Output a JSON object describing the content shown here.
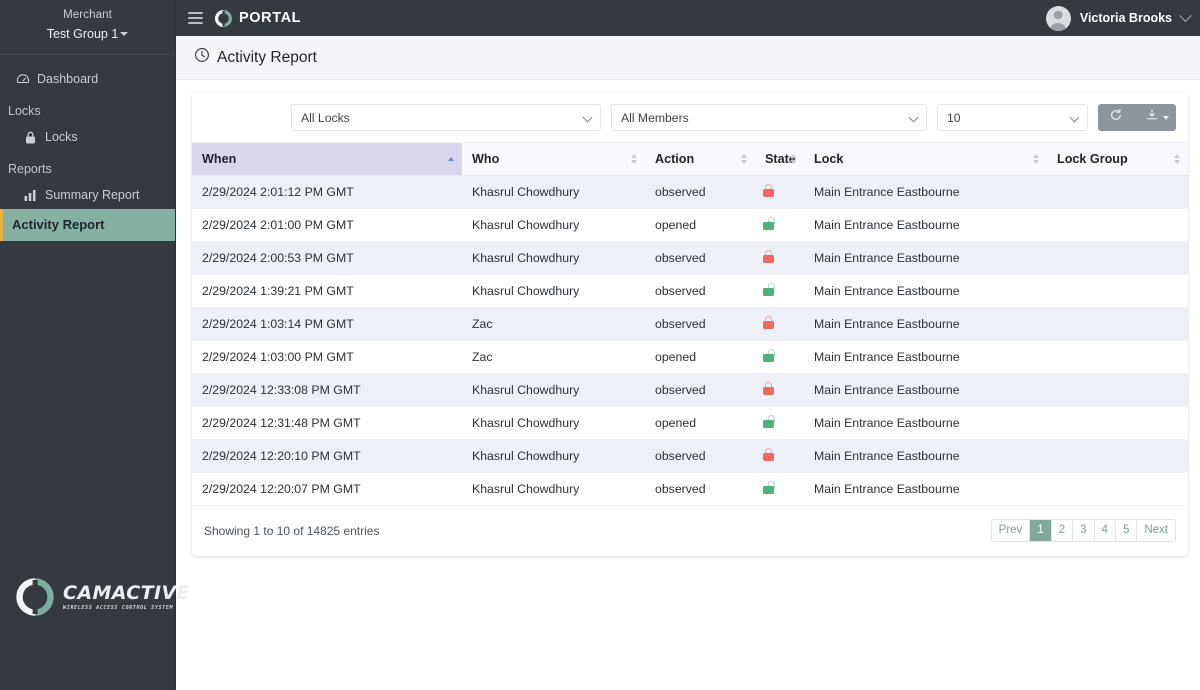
{
  "sidebar": {
    "merchant_label": "Merchant",
    "merchant_group": "Test Group 1",
    "items": [
      {
        "label": "Dashboard",
        "icon": "dashboard-icon",
        "type": "link"
      },
      {
        "label": "Locks",
        "icon": "",
        "type": "section"
      },
      {
        "label": "Locks",
        "icon": "lock-icon",
        "type": "link"
      },
      {
        "label": "Reports",
        "icon": "",
        "type": "section"
      },
      {
        "label": "Summary Report",
        "icon": "bar-chart-icon",
        "type": "link"
      },
      {
        "label": "Activity Report",
        "icon": "",
        "type": "link",
        "active": true
      }
    ],
    "brand": {
      "name": "CAMACTIVE",
      "tagline": "WIRELESS ACCESS CONTROL SYSTEM"
    },
    "colors": {
      "background": "#343a40",
      "active_background": "#85b1a3",
      "active_border": "#e8b33c",
      "brand_accent": "#7fae9e"
    }
  },
  "topbar": {
    "menu_icon": "hamburger-icon",
    "logo_icon": "portal-ring-icon",
    "brand": "PORTAL",
    "user_name": "Victoria Brooks"
  },
  "page": {
    "title": "Activity Report",
    "title_icon": "clock-icon"
  },
  "toolbar": {
    "lock_filter": {
      "value": "All Locks",
      "placeholder": "All Locks"
    },
    "member_filter": {
      "value": "All Members",
      "placeholder": "All Members"
    },
    "page_size": {
      "value": "10"
    },
    "refresh_label": "refresh-icon",
    "export_label": "download-icon"
  },
  "table": {
    "columns": [
      {
        "label": "When",
        "sort": "asc"
      },
      {
        "label": "Who",
        "sort": "none"
      },
      {
        "label": "Action",
        "sort": "none"
      },
      {
        "label": "State",
        "sort": "none"
      },
      {
        "label": "Lock",
        "sort": "none"
      },
      {
        "label": "Lock Group",
        "sort": "none"
      }
    ],
    "rows": [
      {
        "when": "2/29/2024 2:01:12 PM GMT",
        "who": "Khasrul Chowdhury",
        "action": "observed",
        "state": "locked",
        "lock": "Main Entrance Eastbourne",
        "lock_group": ""
      },
      {
        "when": "2/29/2024 2:01:00 PM GMT",
        "who": "Khasrul Chowdhury",
        "action": "opened",
        "state": "unlocked",
        "lock": "Main Entrance Eastbourne",
        "lock_group": ""
      },
      {
        "when": "2/29/2024 2:00:53 PM GMT",
        "who": "Khasrul Chowdhury",
        "action": "observed",
        "state": "locked",
        "lock": "Main Entrance Eastbourne",
        "lock_group": ""
      },
      {
        "when": "2/29/2024 1:39:21 PM GMT",
        "who": "Khasrul Chowdhury",
        "action": "observed",
        "state": "unlocked",
        "lock": "Main Entrance Eastbourne",
        "lock_group": ""
      },
      {
        "when": "2/29/2024 1:03:14 PM GMT",
        "who": "Zac",
        "action": "observed",
        "state": "locked",
        "lock": "Main Entrance Eastbourne",
        "lock_group": ""
      },
      {
        "when": "2/29/2024 1:03:00 PM GMT",
        "who": "Zac",
        "action": "opened",
        "state": "unlocked",
        "lock": "Main Entrance Eastbourne",
        "lock_group": ""
      },
      {
        "when": "2/29/2024 12:33:08 PM GMT",
        "who": "Khasrul Chowdhury",
        "action": "observed",
        "state": "locked",
        "lock": "Main Entrance Eastbourne",
        "lock_group": ""
      },
      {
        "when": "2/29/2024 12:31:48 PM GMT",
        "who": "Khasrul Chowdhury",
        "action": "opened",
        "state": "unlocked",
        "lock": "Main Entrance Eastbourne",
        "lock_group": ""
      },
      {
        "when": "2/29/2024 12:20:10 PM GMT",
        "who": "Khasrul Chowdhury",
        "action": "observed",
        "state": "locked",
        "lock": "Main Entrance Eastbourne",
        "lock_group": ""
      },
      {
        "when": "2/29/2024 12:20:07 PM GMT",
        "who": "Khasrul Chowdhury",
        "action": "observed",
        "state": "unlocked",
        "lock": "Main Entrance Eastbourne",
        "lock_group": ""
      }
    ]
  },
  "footer": {
    "showing": "Showing 1 to 10 of 14825 entries",
    "pagination": [
      {
        "label": "Prev",
        "active": false
      },
      {
        "label": "1",
        "active": true
      },
      {
        "label": "2",
        "active": false
      },
      {
        "label": "3",
        "active": false
      },
      {
        "label": "4",
        "active": false
      },
      {
        "label": "5",
        "active": false
      },
      {
        "label": "Next",
        "active": false
      }
    ]
  },
  "colors": {
    "accent_green": "#7fa99b",
    "locked_red": "#f0685f",
    "unlocked_green": "#4fb07e",
    "sorted_header": "#d8d6ec",
    "sidebar_dark": "#343a40"
  }
}
